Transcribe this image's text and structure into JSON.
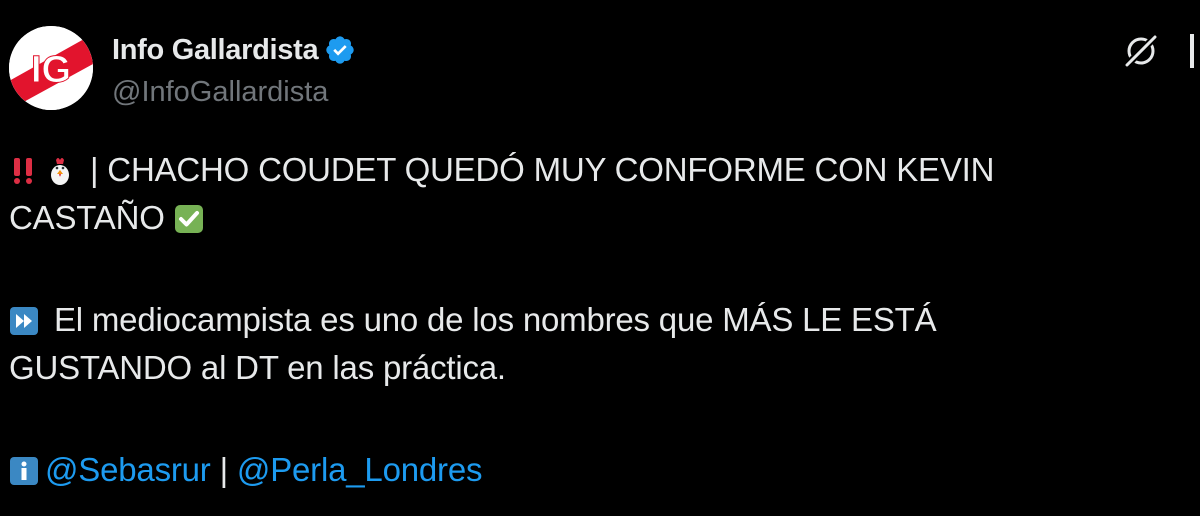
{
  "author": {
    "display_name": "Info Gallardista",
    "handle": "@InfoGallardista",
    "avatar_text": "IG",
    "verified": true
  },
  "icons": {
    "verified": "verified-badge-icon",
    "grok": "grok-icon",
    "more": "more-vertical-icon"
  },
  "colors": {
    "background": "#000000",
    "text": "#e7e9ea",
    "muted": "#71767b",
    "link": "#1d9bf0",
    "verified": "#1d9bf0",
    "avatar_red": "#e2142d"
  },
  "tweet": {
    "line1": " | CHACHO COUDET QUEDÓ MUY CONFORME CON KEVIN",
    "line2": "CASTAÑO ",
    "para2_line1": " El mediocampista es uno de los nombres que MÁS LE ESTÁ",
    "para2_line2": "GUSTANDO al DT en las práctica.",
    "mention1": "@Sebasrur",
    "separator": " | ",
    "mention2": "@Perla_Londres"
  }
}
